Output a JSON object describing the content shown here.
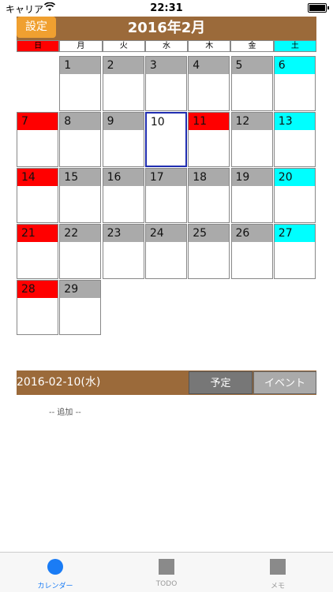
{
  "status": {
    "carrier": "キャリア",
    "time": "22:31"
  },
  "calendar": {
    "title": "2016年2月",
    "settings_label": "設定",
    "weekdays": [
      "日",
      "月",
      "火",
      "水",
      "木",
      "金",
      "土"
    ],
    "weeks": [
      [
        "",
        "1",
        "2",
        "3",
        "4",
        "5",
        "6"
      ],
      [
        "7",
        "8",
        "9",
        "10",
        "11",
        "12",
        "13"
      ],
      [
        "14",
        "15",
        "16",
        "17",
        "18",
        "19",
        "20"
      ],
      [
        "21",
        "22",
        "23",
        "24",
        "25",
        "26",
        "27"
      ],
      [
        "28",
        "29",
        "",
        "",
        "",
        "",
        ""
      ]
    ],
    "selected_day": "10",
    "holiday_day": "11",
    "colors": {
      "header": "#9b6a3a",
      "sunday": "#ff0000",
      "saturday": "#00ffff",
      "weekday": "#aaaaaa",
      "selected_border": "#1f2db0"
    }
  },
  "detail": {
    "date": "2016-02-10(水)",
    "yotei_label": "予定",
    "event_label": "イベント",
    "add_label": "-- 追加 --"
  },
  "tabs": [
    {
      "label": "カレンダー",
      "icon": "calendar-circle-icon",
      "active": true
    },
    {
      "label": "TODO",
      "icon": "todo-square-icon",
      "active": false
    },
    {
      "label": "メモ",
      "icon": "memo-square-icon",
      "active": false
    }
  ]
}
